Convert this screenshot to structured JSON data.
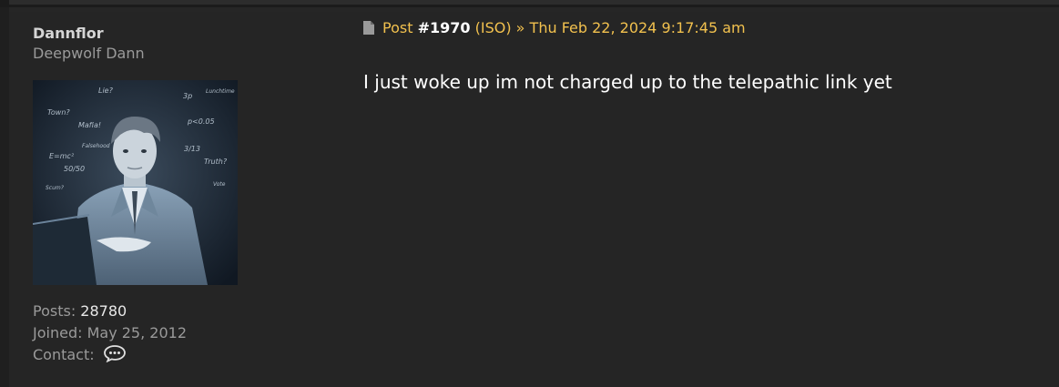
{
  "profile": {
    "username": "Dannflor",
    "rank": "Deepwolf Dann",
    "posts_label": "Posts:",
    "posts_value": "28780",
    "joined_label": "Joined:",
    "joined_value": "May 25, 2012",
    "contact_label": "Contact:",
    "contact_icon": "speech-bubble-icon",
    "avatar_scribbles": [
      "Lie?",
      "3p",
      "Lunchtime",
      "Town?",
      "Mafia!",
      "p<0.05",
      "E=mc²",
      "Falsehood",
      "3/13",
      "Truth?",
      "50/50",
      "Scum?",
      "Vote"
    ]
  },
  "post": {
    "icon": "document-icon",
    "post_word": "Post",
    "post_number": "#1970",
    "iso": "(ISO)",
    "separator": "»",
    "timestamp": "Thu Feb 22, 2024 9:17:45 am",
    "body": "I just woke up im not charged up to the telepathic link yet"
  },
  "colors": {
    "background": "#262626",
    "accent": "#f2c14e",
    "username": "#d5d5d5",
    "muted": "#9a9a9a",
    "body_text": "#ffffff"
  }
}
